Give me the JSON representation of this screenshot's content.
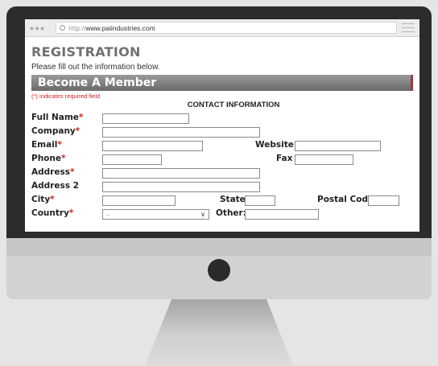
{
  "browser": {
    "url_protocol": "http://",
    "url_host": "www.paiindustries.com"
  },
  "page": {
    "title": "REGISTRATION",
    "subtitle": "Please fill out the information below.",
    "section_title": "Become A Member",
    "required_note": "(*) indicates required field",
    "contact_heading": "CONTACT INFORMATION"
  },
  "form": {
    "full_name": {
      "label": "Full Name",
      "required": "*"
    },
    "company": {
      "label": "Company",
      "required": "*"
    },
    "email": {
      "label": "Email",
      "required": "*"
    },
    "website": {
      "label": "Website"
    },
    "phone": {
      "label": "Phone",
      "required": "*"
    },
    "fax": {
      "label": "Fax"
    },
    "address": {
      "label": "Address",
      "required": "*"
    },
    "address2": {
      "label": "Address 2"
    },
    "city": {
      "label": "City",
      "required": "*"
    },
    "state": {
      "label": "State"
    },
    "postal_code": {
      "label": "Postal Code"
    },
    "country": {
      "label": "Country",
      "required": "*",
      "selected": "..."
    },
    "other": {
      "label": "Other:"
    }
  },
  "icons": {
    "window_dots": "window-controls-icon",
    "search": "search-icon",
    "menu": "hamburger-menu-icon",
    "dropdown": "chevron-down-icon"
  },
  "colors": {
    "required": "#d21f1f",
    "section_band": "#7a7a7a",
    "monitor_bezel": "#2c2c2c"
  }
}
